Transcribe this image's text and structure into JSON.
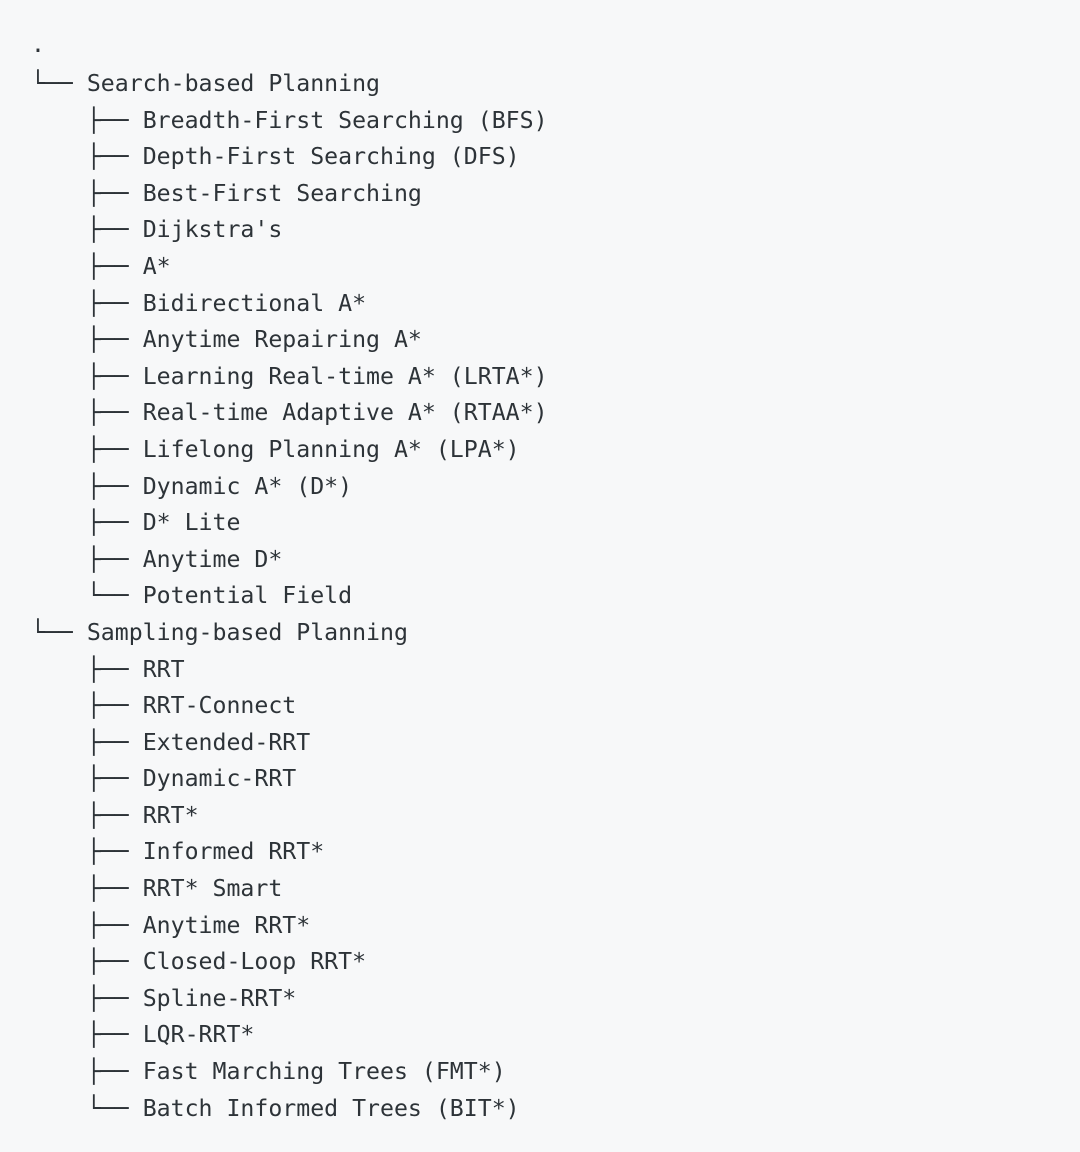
{
  "theme": {
    "background": "#f7f8f9",
    "text_color": "#2d3338"
  },
  "tree": {
    "root_label": ".",
    "lines": [
      {
        "prefix": "",
        "label": "."
      },
      {
        "prefix": "└── ",
        "label": "Search-based Planning"
      },
      {
        "prefix": "    ├── ",
        "label": "Breadth-First Searching (BFS)"
      },
      {
        "prefix": "    ├── ",
        "label": "Depth-First Searching (DFS)"
      },
      {
        "prefix": "    ├── ",
        "label": "Best-First Searching"
      },
      {
        "prefix": "    ├── ",
        "label": "Dijkstra's"
      },
      {
        "prefix": "    ├── ",
        "label": "A*"
      },
      {
        "prefix": "    ├── ",
        "label": "Bidirectional A*"
      },
      {
        "prefix": "    ├── ",
        "label": "Anytime Repairing A*"
      },
      {
        "prefix": "    ├── ",
        "label": "Learning Real-time A* (LRTA*)"
      },
      {
        "prefix": "    ├── ",
        "label": "Real-time Adaptive A* (RTAA*)"
      },
      {
        "prefix": "    ├── ",
        "label": "Lifelong Planning A* (LPA*)"
      },
      {
        "prefix": "    ├── ",
        "label": "Dynamic A* (D*)"
      },
      {
        "prefix": "    ├── ",
        "label": "D* Lite"
      },
      {
        "prefix": "    ├── ",
        "label": "Anytime D*"
      },
      {
        "prefix": "    └── ",
        "label": "Potential Field"
      },
      {
        "prefix": "└── ",
        "label": "Sampling-based Planning"
      },
      {
        "prefix": "    ├── ",
        "label": "RRT"
      },
      {
        "prefix": "    ├── ",
        "label": "RRT-Connect"
      },
      {
        "prefix": "    ├── ",
        "label": "Extended-RRT"
      },
      {
        "prefix": "    ├── ",
        "label": "Dynamic-RRT"
      },
      {
        "prefix": "    ├── ",
        "label": "RRT*"
      },
      {
        "prefix": "    ├── ",
        "label": "Informed RRT*"
      },
      {
        "prefix": "    ├── ",
        "label": "RRT* Smart"
      },
      {
        "prefix": "    ├── ",
        "label": "Anytime RRT*"
      },
      {
        "prefix": "    ├── ",
        "label": "Closed-Loop RRT*"
      },
      {
        "prefix": "    ├── ",
        "label": "Spline-RRT*"
      },
      {
        "prefix": "    ├── ",
        "label": "LQR-RRT*"
      },
      {
        "prefix": "    ├── ",
        "label": "Fast Marching Trees (FMT*)"
      },
      {
        "prefix": "    └── ",
        "label": "Batch Informed Trees (BIT*)"
      }
    ]
  }
}
